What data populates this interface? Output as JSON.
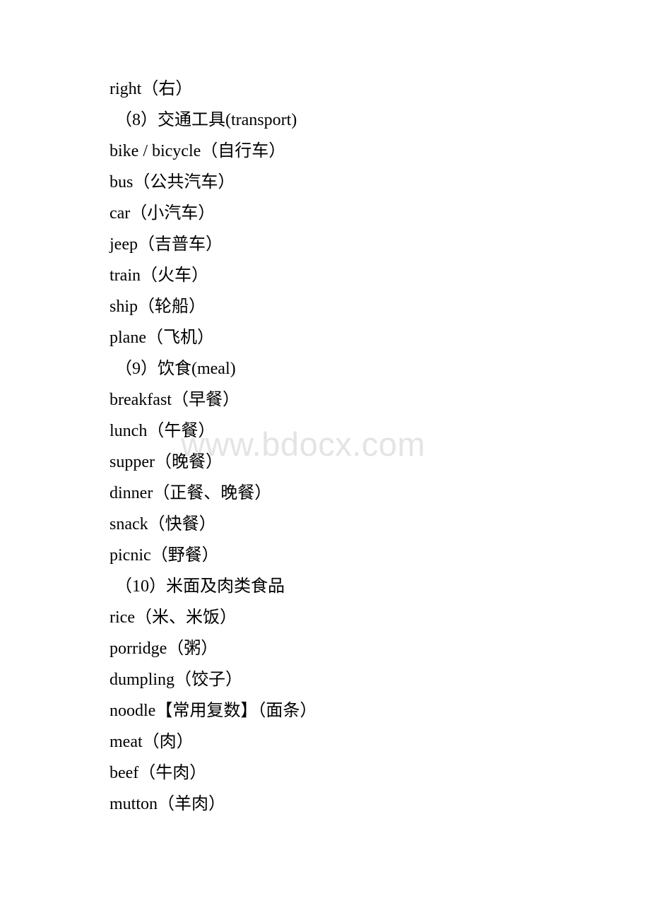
{
  "document": {
    "type": "vocabulary-list",
    "language": "English-Chinese",
    "page_background": "#ffffff",
    "text_color": "#000000"
  },
  "watermark": {
    "text": "www.bdocx.com",
    "color": "#e4e4e5"
  },
  "lines": [
    {
      "id": "right",
      "text": "right（右）",
      "kind": "entry"
    },
    {
      "id": "sec-8-transport",
      "text": "（8）交通工具(transport)",
      "kind": "heading"
    },
    {
      "id": "bike",
      "text": "bike / bicycle（自行车）",
      "kind": "entry"
    },
    {
      "id": "bus",
      "text": "bus（公共汽车）",
      "kind": "entry"
    },
    {
      "id": "car",
      "text": "car（小汽车）",
      "kind": "entry"
    },
    {
      "id": "jeep",
      "text": "jeep（吉普车）",
      "kind": "entry"
    },
    {
      "id": "train",
      "text": "train（火车）",
      "kind": "entry"
    },
    {
      "id": "ship",
      "text": "ship（轮船）",
      "kind": "entry"
    },
    {
      "id": "plane",
      "text": "plane（飞机）",
      "kind": "entry"
    },
    {
      "id": "sec-9-meal",
      "text": "（9）饮食(meal)",
      "kind": "heading"
    },
    {
      "id": "breakfast",
      "text": "breakfast（早餐）",
      "kind": "entry"
    },
    {
      "id": "lunch",
      "text": "lunch（午餐）",
      "kind": "entry"
    },
    {
      "id": "supper",
      "text": "supper（晚餐）",
      "kind": "entry"
    },
    {
      "id": "dinner",
      "text": "dinner（正餐、晚餐）",
      "kind": "entry"
    },
    {
      "id": "snack",
      "text": "snack（快餐）",
      "kind": "entry"
    },
    {
      "id": "picnic",
      "text": "picnic（野餐）",
      "kind": "entry"
    },
    {
      "id": "sec-10-staples",
      "text": "（10）米面及肉类食品",
      "kind": "heading"
    },
    {
      "id": "rice",
      "text": "rice（米、米饭）",
      "kind": "entry"
    },
    {
      "id": "porridge",
      "text": "porridge（粥）",
      "kind": "entry"
    },
    {
      "id": "dumpling",
      "text": "dumpling（饺子）",
      "kind": "entry"
    },
    {
      "id": "noodle",
      "text": "noodle【常用复数】（面条）",
      "kind": "entry"
    },
    {
      "id": "meat",
      "text": "meat（肉）",
      "kind": "entry"
    },
    {
      "id": "beef",
      "text": "beef（牛肉）",
      "kind": "entry"
    },
    {
      "id": "mutton",
      "text": "mutton（羊肉）",
      "kind": "entry"
    }
  ]
}
